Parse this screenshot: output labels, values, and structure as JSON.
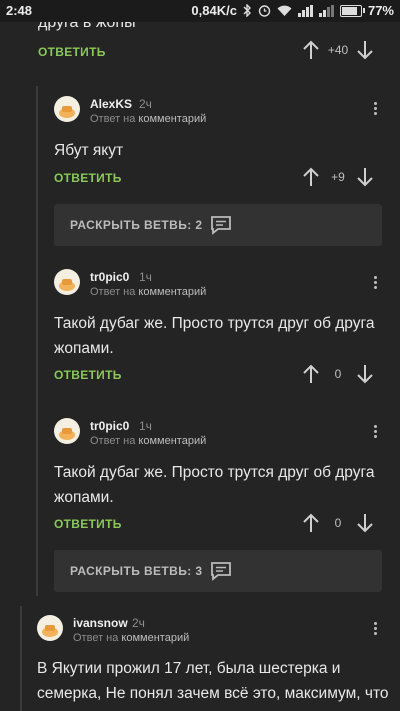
{
  "status_bar": {
    "time": "2:48",
    "network_speed": "0,84K/c",
    "battery": "77%"
  },
  "top_comment": {
    "text_fragment": "друга в жопы",
    "reply_label": "ОТВЕТИТЬ",
    "score": "+40"
  },
  "comments": [
    {
      "username": "AlexKS",
      "time": "2ч",
      "meta_prefix": "Ответ на",
      "meta_link": "комментарий",
      "text": "Ябут якут",
      "reply_label": "ОТВЕТИТЬ",
      "score": "+9"
    },
    {
      "username": "tr0pic0",
      "time": "1ч",
      "meta_prefix": "Ответ на",
      "meta_link": "комментарий",
      "text_line1": "Такой дубаг же. Просто трутся друг об друга",
      "text_line2": "жопами.",
      "reply_label": "ОТВЕТИТЬ",
      "score": "0"
    },
    {
      "username": "tr0pic0",
      "time": "1ч",
      "meta_prefix": "Ответ на",
      "meta_link": "комментарий",
      "text_line1": "Такой дубаг же. Просто трутся друг об друга",
      "text_line2": "жопами.",
      "reply_label": "ОТВЕТИТЬ",
      "score": "0"
    },
    {
      "username": "ivansnow",
      "time": "2ч",
      "meta_prefix": "Ответ на",
      "meta_link": "комментарий",
      "text_line1": "В Якутии прожил 17 лет, была шестерка и",
      "text_line2": "семерка, Не понял зачем всё это, максимум, что"
    }
  ],
  "expand_buttons": [
    {
      "label": "РАСКРЫТЬ ВЕТВЬ: 2"
    },
    {
      "label": "РАСКРЫТЬ ВЕТВЬ: 3"
    }
  ],
  "icons": {
    "upvote": "arrow-up-icon",
    "downvote": "arrow-down-icon",
    "more": "kebab-menu-icon",
    "expand": "chat-bubble-icon"
  },
  "colors": {
    "background": "#242424",
    "reply_accent": "#8ac858",
    "expand_bg": "#323232"
  }
}
